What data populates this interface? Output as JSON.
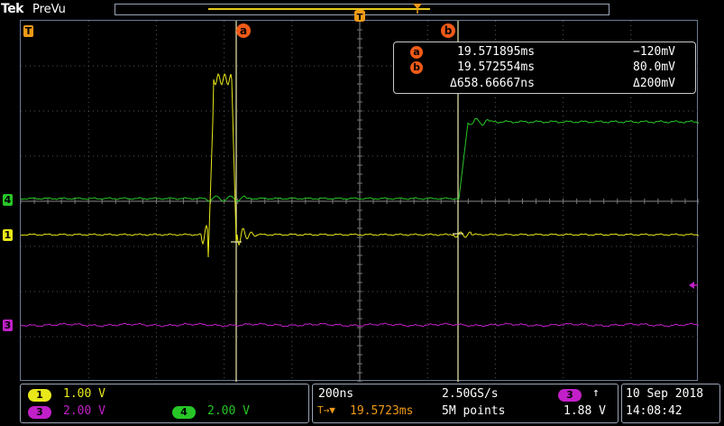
{
  "header": {
    "brand": "Tek",
    "mode": "PreVu"
  },
  "markers": {
    "trigger_pos": "T",
    "ch4": "4",
    "ch1": "1",
    "ch3": "3",
    "cursor_a": "a",
    "cursor_b": "b"
  },
  "readout": {
    "a_label": "a",
    "a_time": "19.571895ms",
    "a_volt": "−120mV",
    "b_label": "b",
    "b_time": "19.572554ms",
    "b_volt": "80.0mV",
    "delta_time": "Δ658.66667ns",
    "delta_volt": "Δ200mV"
  },
  "channels": {
    "ch1_num": "1",
    "ch1_scale": "1.00 V",
    "ch3_num": "3",
    "ch3_scale": "2.00 V",
    "ch4_num": "4",
    "ch4_scale": "2.00 V"
  },
  "horizontal": {
    "timebase": "200ns",
    "sample_rate": "2.50GS/s",
    "delay_icon": "T→▼",
    "delay": "19.5723ms",
    "record_length": "5M points"
  },
  "trigger": {
    "source": "3",
    "slope_icon": "↑",
    "level": "1.88 V"
  },
  "datetime": {
    "date": "10 Sep  2018",
    "time": "14:08:42"
  },
  "colors": {
    "ch1": "#e8e81a",
    "ch3": "#c21fc8",
    "ch4": "#27c627",
    "cursor": "#f05a18",
    "trigger_marker": "#f09a18"
  }
}
